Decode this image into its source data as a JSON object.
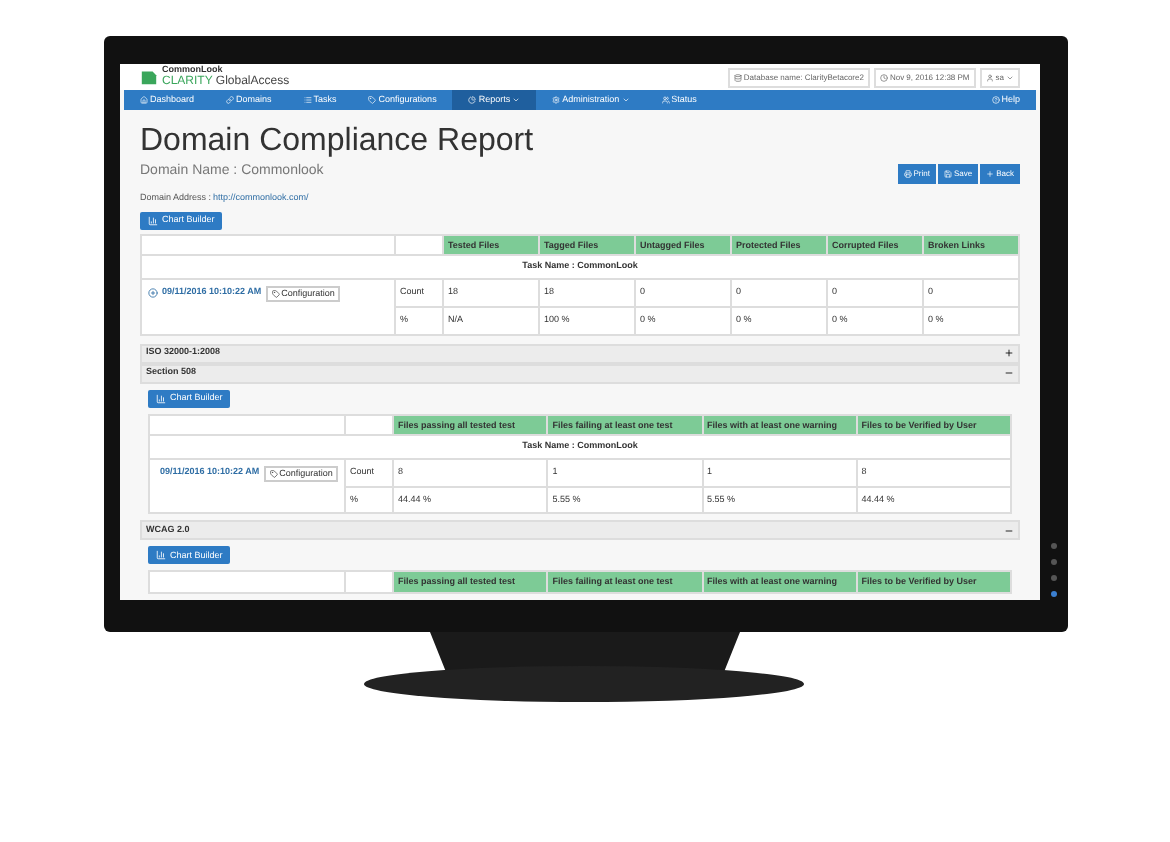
{
  "brand": {
    "maker": "CommonLook",
    "name": "CLARITY",
    "product": "GlobalAccess"
  },
  "header_info": [
    "Database name: ClarityBetacore2",
    "Nov 9, 2016 12:38 PM"
  ],
  "user": "sa",
  "nav": [
    {
      "label": "Dashboard",
      "selected": false,
      "has_menu": false
    },
    {
      "label": "Domains",
      "selected": false,
      "has_menu": false
    },
    {
      "label": "Tasks",
      "selected": false,
      "has_menu": false
    },
    {
      "label": "Configurations",
      "selected": false,
      "has_menu": false
    },
    {
      "label": "Reports",
      "selected": true,
      "has_menu": true
    },
    {
      "label": "Administration",
      "selected": false,
      "has_menu": true
    },
    {
      "label": "Status",
      "selected": false,
      "has_menu": false
    }
  ],
  "help": "Help",
  "title": "Domain Compliance Report",
  "domain_name": "Domain Name : Commonlook",
  "actions": [
    "Print",
    "Save",
    "Back"
  ],
  "domain_address": {
    "label": "Domain Address :",
    "link": "http://commonlook.com/"
  },
  "summary": {
    "chart_button": "Chart Builder",
    "columns": [
      "Tested Files",
      "Tagged Files",
      "Untagged Files",
      "Protected Files",
      "Corrupted Files",
      "Broken Links"
    ],
    "task_name": "Task Name : CommonLook",
    "run": {
      "date": "09/11/2016 10:10:22 AM",
      "config": "Configuration"
    },
    "rows": [
      {
        "label": "Count",
        "cells": [
          "18",
          "18",
          "0",
          "0",
          "0",
          "0"
        ]
      },
      {
        "label": "%",
        "cells": [
          "N/A",
          "100 %",
          "0 %",
          "0 %",
          "0 %",
          "0 %"
        ]
      }
    ]
  },
  "sections": [
    {
      "title": "ISO 32000-1:2008",
      "expanded": false
    },
    {
      "title": "Section 508",
      "expanded": true,
      "chart_button": "Chart Builder",
      "columns": [
        "Files passing all tested test",
        "Files failing at least one test",
        "Files with at least one warning",
        "Files to be Verified by User"
      ],
      "task_name": "Task Name : CommonLook",
      "run": {
        "date": "09/11/2016 10:10:22 AM",
        "config": "Configuration"
      },
      "rows": [
        {
          "label": "Count",
          "cells": [
            "8",
            "1",
            "1",
            "8"
          ]
        },
        {
          "label": "%",
          "cells": [
            "44.44 %",
            "5.55 %",
            "5.55 %",
            "44.44 %"
          ]
        }
      ]
    },
    {
      "title": "WCAG 2.0",
      "expanded": true,
      "chart_button": "Chart Builder",
      "columns": [
        "Files passing all tested test",
        "Files failing at least one test",
        "Files with at least one warning",
        "Files to be Verified by User"
      ]
    }
  ]
}
